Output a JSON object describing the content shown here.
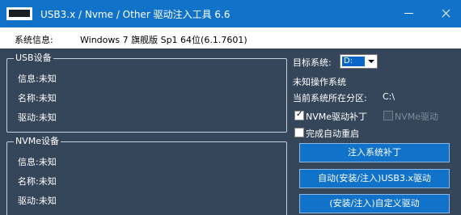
{
  "window": {
    "title": "USB3.x / Nvme / Other 驱动注入工具 6.6"
  },
  "sysinfo": {
    "label": "系统信息:",
    "value": "Windows 7 旗舰版 Sp1 64位(6.1.7601)"
  },
  "usb_group": {
    "title": "USB设备",
    "info": "信息:未知",
    "name": "名称:未知",
    "driver": "驱动:未知"
  },
  "nvme_group": {
    "title": "NVMe设备",
    "info": "信息:未知",
    "name": "名称:未知",
    "driver": "驱动:未知"
  },
  "right": {
    "target_label": "目标系统:",
    "target_value": "D:",
    "os_status": "未知操作系统",
    "partition_label": "当前系统所在分区:",
    "partition_value": "C:\\",
    "nvme_patch_label": "NVMe驱动补丁",
    "nvme_patch_checked": true,
    "nvme_driver_label": "NVMe驱动",
    "nvme_driver_enabled": false,
    "reboot_label": "完成自动重启",
    "reboot_checked": false
  },
  "buttons": {
    "inject_patch": "注入系统补丁",
    "auto_usb3": "自动(安装/注入)USB3.x驱动",
    "custom_driver": "(安装/注入)自定义驱动"
  },
  "colors": {
    "titlebar": "#1172c9",
    "body": "#35465a",
    "button": "#1172c9"
  }
}
